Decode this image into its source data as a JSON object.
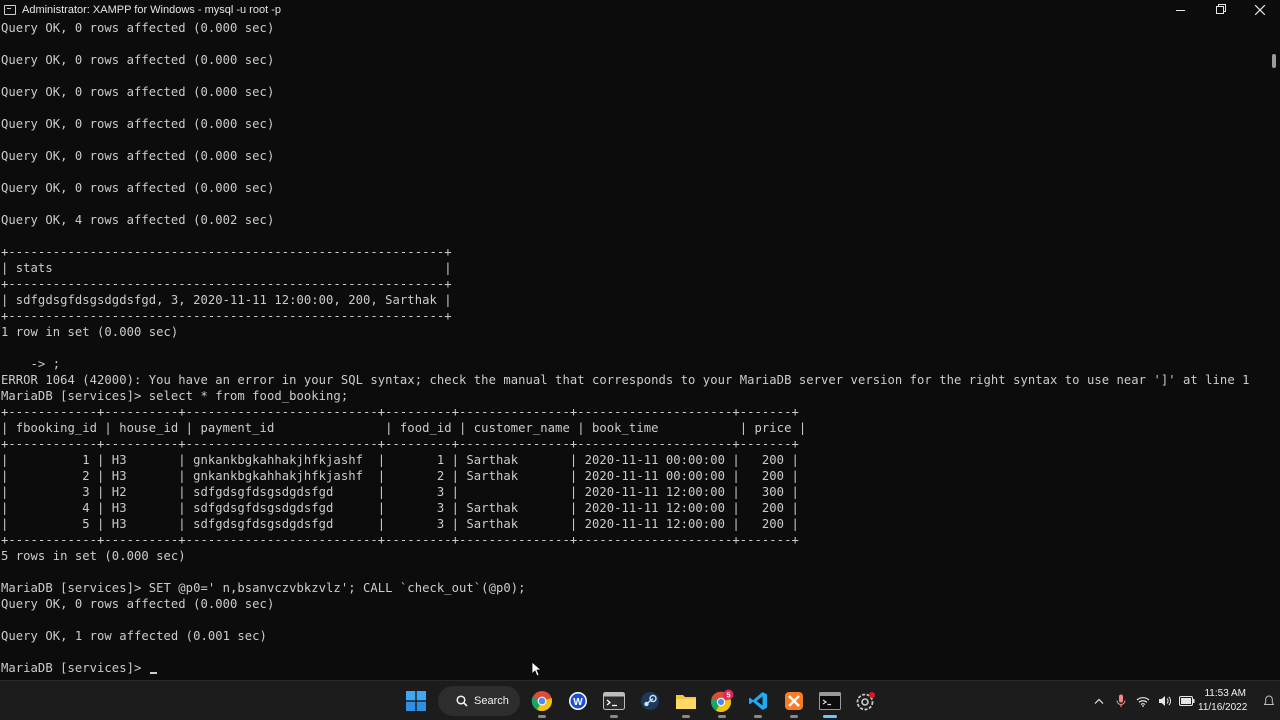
{
  "window": {
    "title": "Administrator:  XAMPP for Windows - mysql  -u root -p",
    "icon": "console-icon",
    "buttons": [
      "minimize",
      "maximize",
      "close"
    ]
  },
  "console": {
    "lines": [
      "Query OK, 0 rows affected (0.000 sec)",
      "",
      "Query OK, 0 rows affected (0.000 sec)",
      "",
      "Query OK, 0 rows affected (0.000 sec)",
      "",
      "Query OK, 0 rows affected (0.000 sec)",
      "",
      "Query OK, 0 rows affected (0.000 sec)",
      "",
      "Query OK, 0 rows affected (0.000 sec)",
      "",
      "Query OK, 4 rows affected (0.002 sec)",
      "",
      "+-----------------------------------------------------------+",
      "| stats                                                     |",
      "+-----------------------------------------------------------+",
      "| sdfgdsgfdsgsdgdsfgd, 3, 2020-11-11 12:00:00, 200, Sarthak |",
      "+-----------------------------------------------------------+",
      "1 row in set (0.000 sec)",
      "",
      "    -> ;",
      "ERROR 1064 (42000): You have an error in your SQL syntax; check the manual that corresponds to your MariaDB server version for the right syntax to use near ']' at line 1",
      "MariaDB [services]> select * from food_booking;",
      "+------------+----------+--------------------------+---------+---------------+---------------------+-------+",
      "| fbooking_id | house_id | payment_id               | food_id | customer_name | book_time           | price |",
      "+------------+----------+--------------------------+---------+---------------+---------------------+-------+",
      "|          1 | H3       | gnkankbgkahhakjhfkjashf  |       1 | Sarthak       | 2020-11-11 00:00:00 |   200 |",
      "|          2 | H3       | gnkankbgkahhakjhfkjashf  |       2 | Sarthak       | 2020-11-11 00:00:00 |   200 |",
      "|          3 | H2       | sdfgdsgfdsgsdgdsfgd      |       3 |               | 2020-11-11 12:00:00 |   300 |",
      "|          4 | H3       | sdfgdsgfdsgsdgdsfgd      |       3 | Sarthak       | 2020-11-11 12:00:00 |   200 |",
      "|          5 | H3       | sdfgdsgfdsgsdgdsfgd      |       3 | Sarthak       | 2020-11-11 12:00:00 |   200 |",
      "+------------+----------+--------------------------+---------+---------------+---------------------+-------+",
      "5 rows in set (0.000 sec)",
      "",
      "MariaDB [services]> SET @p0=' n,bsanvczvbkzvlz'; CALL `check_out`(@p0);",
      "Query OK, 0 rows affected (0.000 sec)",
      "",
      "Query OK, 1 row affected (0.001 sec)",
      "",
      "MariaDB [services]> "
    ]
  },
  "taskbar": {
    "search_label": "Search",
    "apps": [
      {
        "name": "start-icon"
      },
      {
        "name": "search"
      },
      {
        "name": "chrome-icon"
      },
      {
        "name": "word-icon"
      },
      {
        "name": "terminal-icon"
      },
      {
        "name": "steam-icon"
      },
      {
        "name": "file-explorer-icon"
      },
      {
        "name": "chrome-profile-icon",
        "badge": "5"
      },
      {
        "name": "vscode-icon"
      },
      {
        "name": "xampp-icon"
      },
      {
        "name": "cmd-icon",
        "active": true
      },
      {
        "name": "settings-icon"
      }
    ],
    "time": "11:53 AM",
    "date": "11/16/2022"
  },
  "colors": {
    "console_bg": "#0c0c0c",
    "console_fg": "#cccccc",
    "taskbar_bg": "#1c1c1c"
  }
}
